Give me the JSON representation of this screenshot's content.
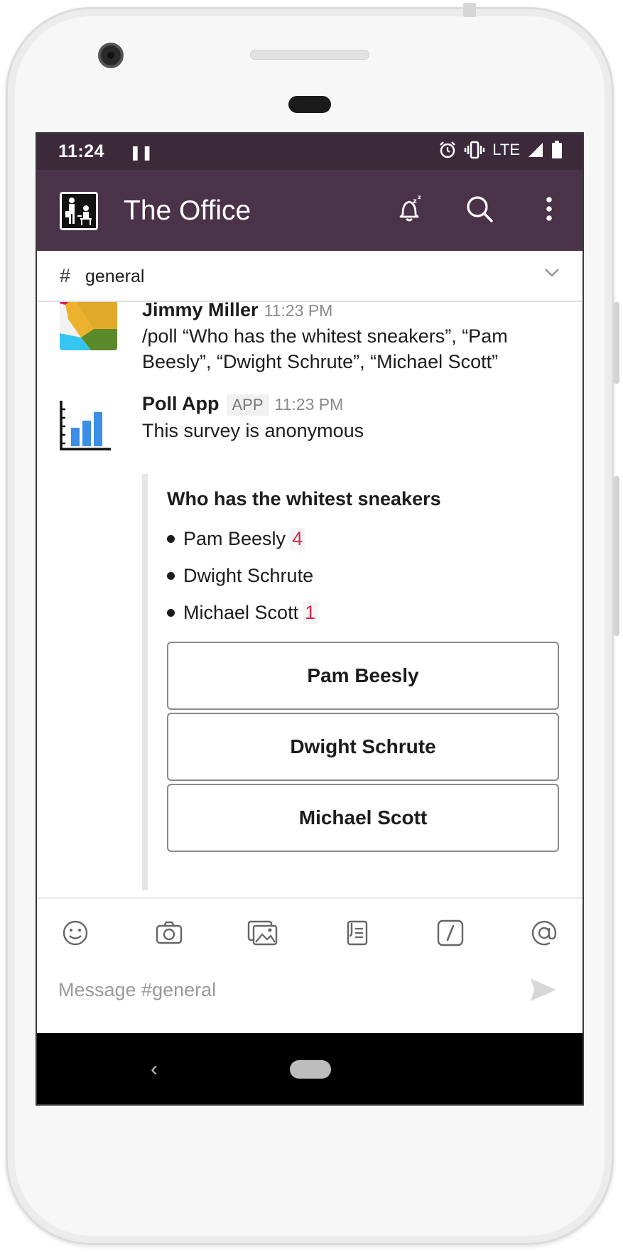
{
  "status_bar": {
    "time": "11:24",
    "network": "LTE"
  },
  "app_bar": {
    "workspace_title": "The Office"
  },
  "channel": {
    "hash": "#",
    "name": "general"
  },
  "messages": [
    {
      "author": "Jimmy Miller",
      "time": "11:23 PM",
      "text": "/poll “Who has the whitest sneakers”, “Pam Beesly”, “Dwight Schrute”, “Michael Scott”"
    },
    {
      "author": "Poll App",
      "badge": "APP",
      "time": "11:23 PM",
      "text": "This survey is anonymous"
    }
  ],
  "poll": {
    "question": "Who has the whitest sneakers",
    "options": [
      {
        "label": "Pam Beesly",
        "votes": "4"
      },
      {
        "label": "Dwight Schrute",
        "votes": ""
      },
      {
        "label": "Michael Scott",
        "votes": "1"
      }
    ],
    "buttons": [
      "Pam Beesly",
      "Dwight Schrute",
      "Michael Scott"
    ]
  },
  "composer": {
    "placeholder": "Message #general"
  },
  "colors": {
    "status_bar": "#3c2a3b",
    "app_bar": "#4a3248",
    "vote_count": "#d62a4b"
  }
}
